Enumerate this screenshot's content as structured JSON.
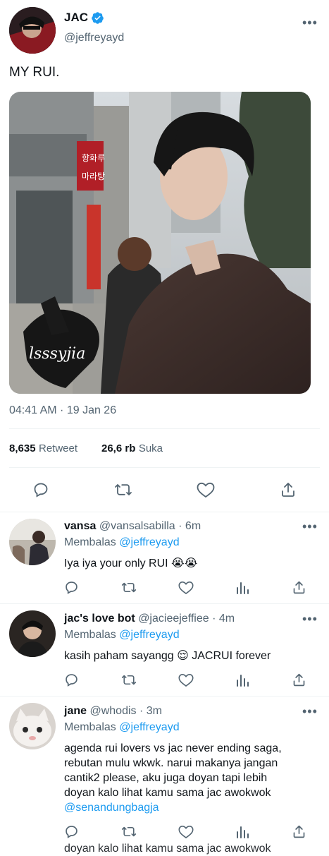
{
  "tweet": {
    "author_name": "JAC",
    "author_handle": "@jeffreyayd",
    "text": "MY RUI.",
    "watermark": "lsssyjia",
    "timestamp": "04:41 AM · 19 Jan 26",
    "retweets_count": "8,635",
    "retweets_label": "Retweet",
    "likes_count": "26,6 rb",
    "likes_label": "Suka",
    "photo_signs": [
      "향화루",
      "마라탕"
    ]
  },
  "replies": [
    {
      "name": "vansa",
      "handle": "@vansalsabilla",
      "time": "· 6m",
      "replying_prefix": "Membalas",
      "replying_to": "@jeffreyayd",
      "text": "Iya iya your only RUI 😭😭"
    },
    {
      "name": "jac's love bot",
      "handle": "@jacieejeffiee",
      "time": "· 4m",
      "replying_prefix": "Membalas",
      "replying_to": "@jeffreyayd",
      "text": "kasih paham sayangg 😌 JACRUI forever"
    },
    {
      "name": "jane",
      "handle": "@whodis",
      "time": "· 3m",
      "replying_prefix": "Membalas",
      "replying_to": "@jeffreyayd",
      "text_lines": [
        "agenda rui lovers vs jac never ending saga,",
        "rebutan mulu wkwk. narui makanya jangan",
        "cantik2 please, aku juga doyan tapi lebih",
        "doyan kalo lihat kamu sama jac awokwok"
      ],
      "mention": "@senandungbagja",
      "cutoff_text": "doyan kalo lihat kamu sama jac awokwok"
    }
  ],
  "colors": {
    "accent": "#1d9bf0",
    "text": "#0f1419",
    "muted": "#536471",
    "divider": "#eff3f4"
  },
  "icons": [
    "verified-badge-icon",
    "more-dots-icon",
    "reply-icon",
    "retweet-icon",
    "like-icon",
    "share-icon",
    "views-icon"
  ]
}
